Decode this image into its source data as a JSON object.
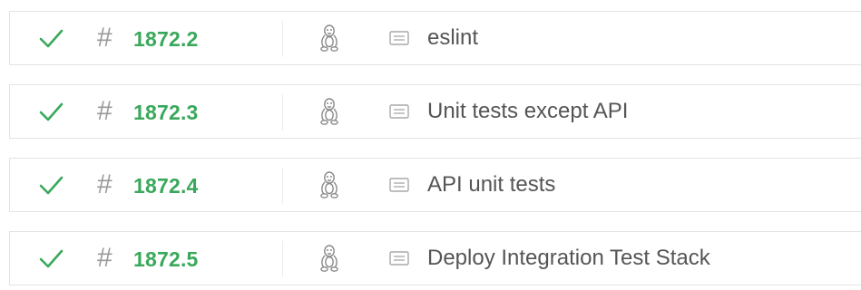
{
  "jobs": [
    {
      "status": "passed",
      "status_icon": "check-icon",
      "number": "1872.2",
      "os_icon": "linux-tux-icon",
      "name": "eslint"
    },
    {
      "status": "passed",
      "status_icon": "check-icon",
      "number": "1872.3",
      "os_icon": "linux-tux-icon",
      "name": "Unit tests except API"
    },
    {
      "status": "passed",
      "status_icon": "check-icon",
      "number": "1872.4",
      "os_icon": "linux-tux-icon",
      "name": "API unit tests"
    },
    {
      "status": "passed",
      "status_icon": "check-icon",
      "number": "1872.5",
      "os_icon": "linux-tux-icon",
      "name": "Deploy Integration Test Stack"
    }
  ],
  "hash_symbol": "#",
  "colors": {
    "passed": "#39a85b",
    "hash": "#9a9a9a",
    "name_text": "#555555",
    "row_border": "#e3e3e3"
  }
}
